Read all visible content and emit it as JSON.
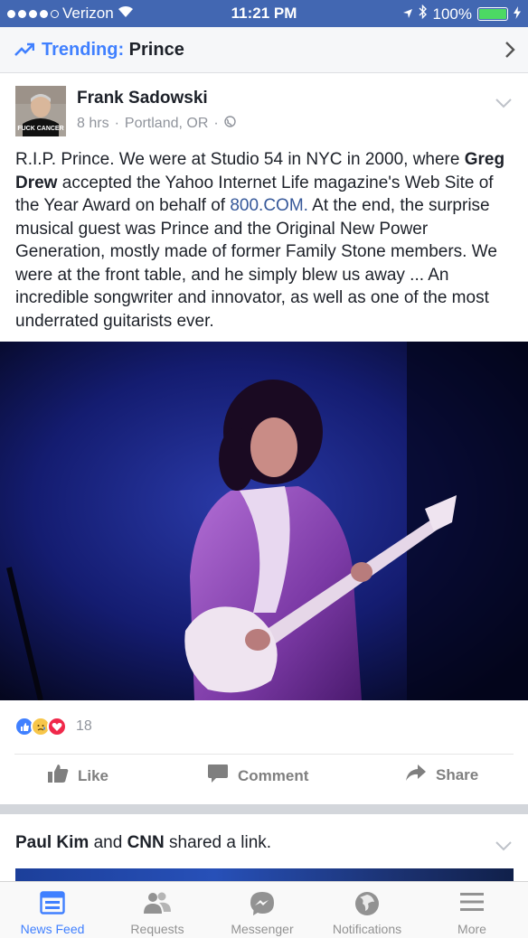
{
  "status_bar": {
    "carrier": "Verizon",
    "time": "11:21 PM",
    "battery": "100%",
    "signal_bars_filled": 4,
    "signal_bars_total": 5
  },
  "trending": {
    "label": "Trending:",
    "topic": "Prince"
  },
  "post": {
    "author": "Frank Sadowski",
    "time_ago": "8 hrs",
    "location": "Portland, OR",
    "text_before_name": "R.I.P. Prince. We were at Studio 54 in NYC in 2000, where ",
    "tagged_name": "Greg Drew",
    "text_middle": " accepted the Yahoo Internet Life magazine's Web Site of the Year Award on behalf of ",
    "link_text": "800.COM.",
    "text_after_link": " At the end, the surprise musical guest was Prince and the Original New Power Generation, mostly made of former Family Stone members. We were at the front table, and he simply blew us away ... An incredible songwriter and innovator, as well as one of the most underrated guitarists ever.",
    "reaction_count": "18",
    "avatar_shirt_text": "FUCK CANCER",
    "actions": {
      "like": "Like",
      "comment": "Comment",
      "share": "Share"
    }
  },
  "next_story": {
    "user1": "Paul Kim",
    "connector": "and",
    "user2": "CNN",
    "suffix": "shared a link."
  },
  "tab_bar": {
    "tabs": [
      {
        "label": "News Feed",
        "active": true
      },
      {
        "label": "Requests",
        "active": false
      },
      {
        "label": "Messenger",
        "active": false
      },
      {
        "label": "Notifications",
        "active": false
      },
      {
        "label": "More",
        "active": false
      }
    ]
  },
  "colors": {
    "status_bar": "#4267b2",
    "accent": "#4080ff",
    "link": "#365899",
    "secondary_text": "#90949c",
    "battery_green": "#4cd964"
  }
}
